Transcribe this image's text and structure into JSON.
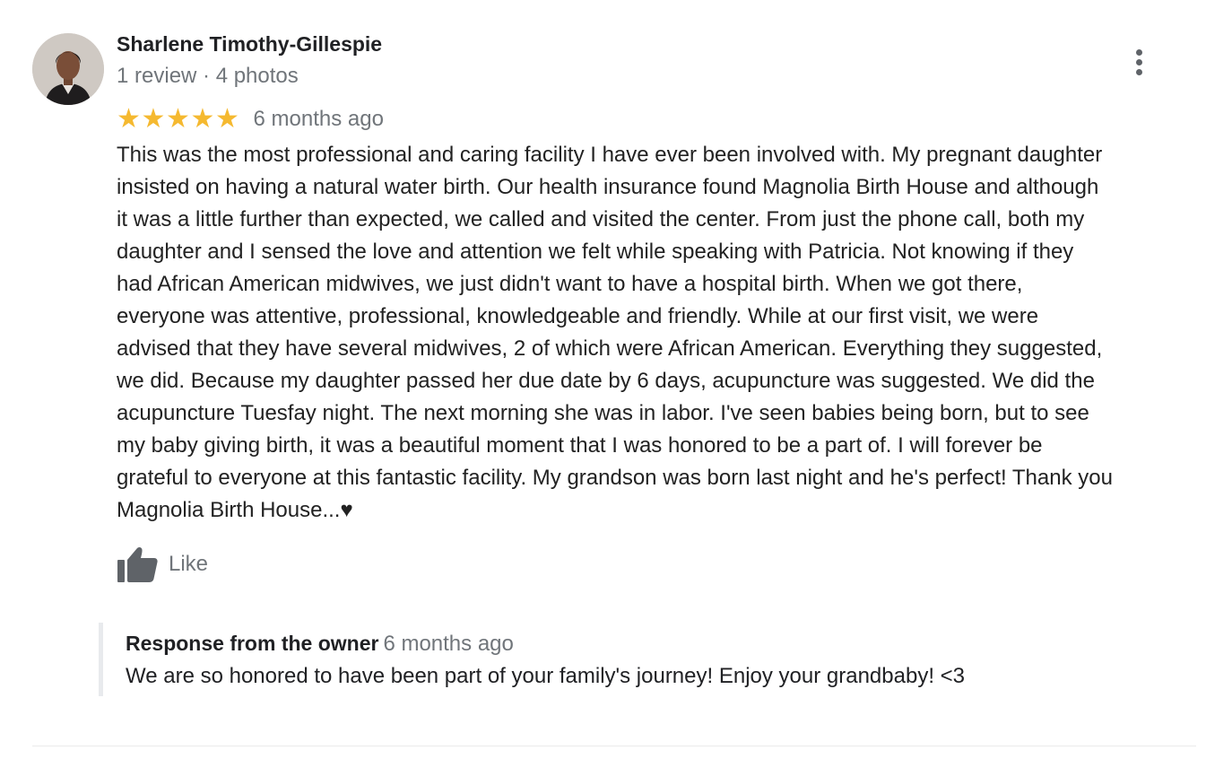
{
  "review": {
    "author": {
      "name": "Sharlene Timothy-Gillespie",
      "meta": "1 review · 4 photos"
    },
    "rating": 5,
    "date": "6 months ago",
    "text_lines": [
      "This was the most professional and caring facility I have ever been involved with. My pregnant daughter",
      "insisted on having a natural water birth. Our health insurance found Magnolia Birth House and although",
      "it was a little further than expected, we called and visited the center. From just the phone call, both my",
      "daughter and I sensed the love and attention we felt while speaking with Patricia. Not knowing if they",
      "had African American midwives, we just didn't want to have a hospital birth. When we got there,",
      "everyone was attentive, professional,  knowledgeable and friendly. While at our first visit, we were",
      "advised that they have several midwives, 2 of which were African American. Everything they suggested,",
      "we did. Because my daughter passed her due date by 6 days, acupuncture was suggested.  We did the",
      "acupuncture Tuesfay night. The next morning she was in labor. I've seen babies being born, but to see",
      "my baby giving birth, it was a beautiful moment that I was honored to be a part of. I will forever be",
      "grateful to everyone at this fantastic facility. My grandson was born last night and he's perfect! Thank you",
      "Magnolia Birth House...♥"
    ],
    "like_label": "Like"
  },
  "owner_response": {
    "title": "Response from the owner",
    "date": "6 months ago",
    "text": "We are so honored to have been part of your family's journey! Enjoy your grandbaby! <3"
  },
  "colors": {
    "star": "#f5b930",
    "secondary_text": "#70757a",
    "icon": "#5f6368"
  },
  "icons": {
    "more": "more-vert-icon",
    "like": "thumbs-up-icon",
    "star": "star-icon"
  }
}
